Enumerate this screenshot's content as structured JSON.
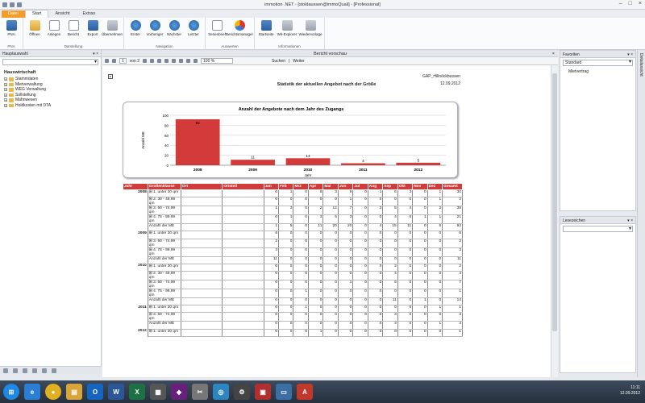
{
  "window": {
    "title": "immotion .NET - [stoldaussen@immoQuali] - [Professional]"
  },
  "tabs": [
    "Datei",
    "Start",
    "Ansicht",
    "Extras"
  ],
  "ribbon": {
    "groups": [
      {
        "label": "PNA",
        "buttons": [
          "PNA"
        ]
      },
      {
        "label": "Darstellung",
        "buttons": [
          "Öffnen",
          "Anlegen",
          "Bericht",
          "Export",
          "Übernehmen"
        ]
      },
      {
        "label": "Navigation",
        "buttons": [
          "Erster",
          "Vorheriger",
          "Nächster",
          "Letzter"
        ]
      },
      {
        "label": "Auswerten",
        "buttons": [
          "Serienbrief",
          "Berichtsmanager"
        ]
      },
      {
        "label": "Informationen",
        "buttons": [
          "Startseite",
          "Wit-Explorer",
          "Wiedervorlage"
        ]
      }
    ]
  },
  "left_panel": {
    "header": "Hauptauswahl",
    "tree_title": "Hauswirtschaft",
    "items": [
      "Stammdaten",
      "Mietverwaltung",
      "WEG Verwaltung",
      "Sollstellung",
      "Mahnwesen",
      "Holdkosten mit DTA"
    ]
  },
  "viewer": {
    "title": "Bericht vorschau",
    "page_current": "1",
    "page_of": "von 2",
    "zoom": "100 %",
    "search": "Suchen",
    "next": "Weiter"
  },
  "report": {
    "company": "GAP_Hillnöckbussen",
    "date": "12.09.2012",
    "title": "Statistik der aktuellen Angebot nach der Größe"
  },
  "chart_data": {
    "type": "bar",
    "title": "Anzahl der Angebote nach dem Jahr des Zugangs",
    "xlabel": "Jahr",
    "ylabel": "Anzahl ME",
    "categories": [
      "2008",
      "2009",
      "2010",
      "2011",
      "2012"
    ],
    "values": [
      92,
      11,
      14,
      4,
      5
    ],
    "ylim": [
      0,
      100
    ],
    "yticks": [
      0,
      20,
      40,
      60,
      80,
      100
    ],
    "grid": true,
    "color": "#d33a3a"
  },
  "table": {
    "headers": [
      "Jahr",
      "Großenklasse",
      "Ort",
      "Ortsteil",
      "Jan",
      "Feb",
      "Mrz",
      "Apr",
      "Mai",
      "Jun",
      "Jul",
      "Aug",
      "Sep",
      "Okt",
      "Nov",
      "Dez",
      "Gesamt"
    ],
    "rows": [
      [
        "2008",
        "⊞ 1. unter 30 qm",
        "",
        "",
        "0",
        "1",
        "0",
        "6",
        "3",
        "9",
        "0",
        "1",
        "6",
        "3",
        "0",
        "1",
        "30"
      ],
      [
        "",
        "⊞ 2. 30 - 49,99 qm",
        "",
        "",
        "0",
        "0",
        "0",
        "0",
        "0",
        "1",
        "0",
        "0",
        "0",
        "0",
        "0",
        "1",
        "2"
      ],
      [
        "",
        "⊞ 3. 50 - 74,99 qm",
        "",
        "",
        "1",
        "3",
        "0",
        "2",
        "12",
        "7",
        "0",
        "3",
        "5",
        "4",
        "0",
        "2",
        "39"
      ],
      [
        "",
        "⊞ 4. 75 - 99,99 qm",
        "",
        "",
        "0",
        "1",
        "0",
        "3",
        "5",
        "3",
        "0",
        "0",
        "4",
        "0",
        "1",
        "1",
        "21"
      ],
      [
        "",
        "Anzahl der ME",
        "",
        "",
        "1",
        "5",
        "0",
        "11",
        "20",
        "20",
        "0",
        "4",
        "15",
        "11",
        "0",
        "5",
        "92"
      ],
      [
        "2009",
        "⊞ 1. unter 30 qm",
        "",
        "",
        "6",
        "0",
        "0",
        "0",
        "0",
        "0",
        "0",
        "0",
        "0",
        "0",
        "0",
        "0",
        "6"
      ],
      [
        "",
        "⊞ 3. 50 - 74,99 qm",
        "",
        "",
        "2",
        "0",
        "0",
        "0",
        "0",
        "0",
        "0",
        "0",
        "0",
        "0",
        "0",
        "0",
        "2"
      ],
      [
        "",
        "⊞ 4. 75 - 99,99 qm",
        "",
        "",
        "3",
        "0",
        "0",
        "0",
        "0",
        "0",
        "0",
        "0",
        "0",
        "0",
        "0",
        "0",
        "3"
      ],
      [
        "",
        "Anzahl der ME",
        "",
        "",
        "11",
        "0",
        "0",
        "0",
        "0",
        "0",
        "0",
        "0",
        "0",
        "0",
        "0",
        "0",
        "11"
      ],
      [
        "2010",
        "⊞ 1. unter 30 qm",
        "",
        "",
        "0",
        "0",
        "0",
        "0",
        "0",
        "0",
        "0",
        "0",
        "2",
        "0",
        "0",
        "0",
        "2"
      ],
      [
        "",
        "⊞ 2. 30 - 49,99 qm",
        "",
        "",
        "0",
        "0",
        "0",
        "0",
        "0",
        "0",
        "0",
        "0",
        "4",
        "0",
        "0",
        "0",
        "4"
      ],
      [
        "",
        "⊞ 3. 50 - 74,99 qm",
        "",
        "",
        "0",
        "0",
        "0",
        "0",
        "0",
        "1",
        "0",
        "0",
        "5",
        "0",
        "0",
        "0",
        "7"
      ],
      [
        "",
        "⊞ 4. 75 - 99,99 qm",
        "",
        "",
        "0",
        "0",
        "1",
        "0",
        "0",
        "0",
        "0",
        "0",
        "0",
        "0",
        "0",
        "0",
        "1"
      ],
      [
        "",
        "Anzahl der ME",
        "",
        "",
        "0",
        "0",
        "0",
        "0",
        "0",
        "0",
        "0",
        "0",
        "11",
        "0",
        "1",
        "0",
        "14"
      ],
      [
        "2011",
        "⊞ 1. unter 30 qm",
        "",
        "",
        "0",
        "0",
        "1",
        "0",
        "0",
        "0",
        "0",
        "0",
        "0",
        "0",
        "0",
        "1",
        "1"
      ],
      [
        "",
        "⊞ 3. 50 - 74,99 qm",
        "",
        "",
        "0",
        "0",
        "0",
        "0",
        "0",
        "0",
        "0",
        "0",
        "3",
        "0",
        "0",
        "0",
        "3"
      ],
      [
        "",
        "Anzahl der ME",
        "",
        "",
        "0",
        "0",
        "0",
        "0",
        "0",
        "0",
        "0",
        "0",
        "3",
        "0",
        "0",
        "1",
        "4"
      ],
      [
        "2012",
        "⊞ 1. unter 30 qm",
        "",
        "",
        "0",
        "0",
        "0",
        "1",
        "0",
        "0",
        "0",
        "0",
        "0",
        "0",
        "0",
        "0",
        "1"
      ]
    ]
  },
  "right_panel": {
    "favoriten_header": "Favoriten",
    "favoriten_select": "Standard",
    "favoriten_item": "Mietvertrag",
    "lesezeichen_header": "Lesezeichen",
    "side_tab": "Detailansicht"
  },
  "taskbar": {
    "time": "11:11",
    "date": "12.09.2012"
  }
}
